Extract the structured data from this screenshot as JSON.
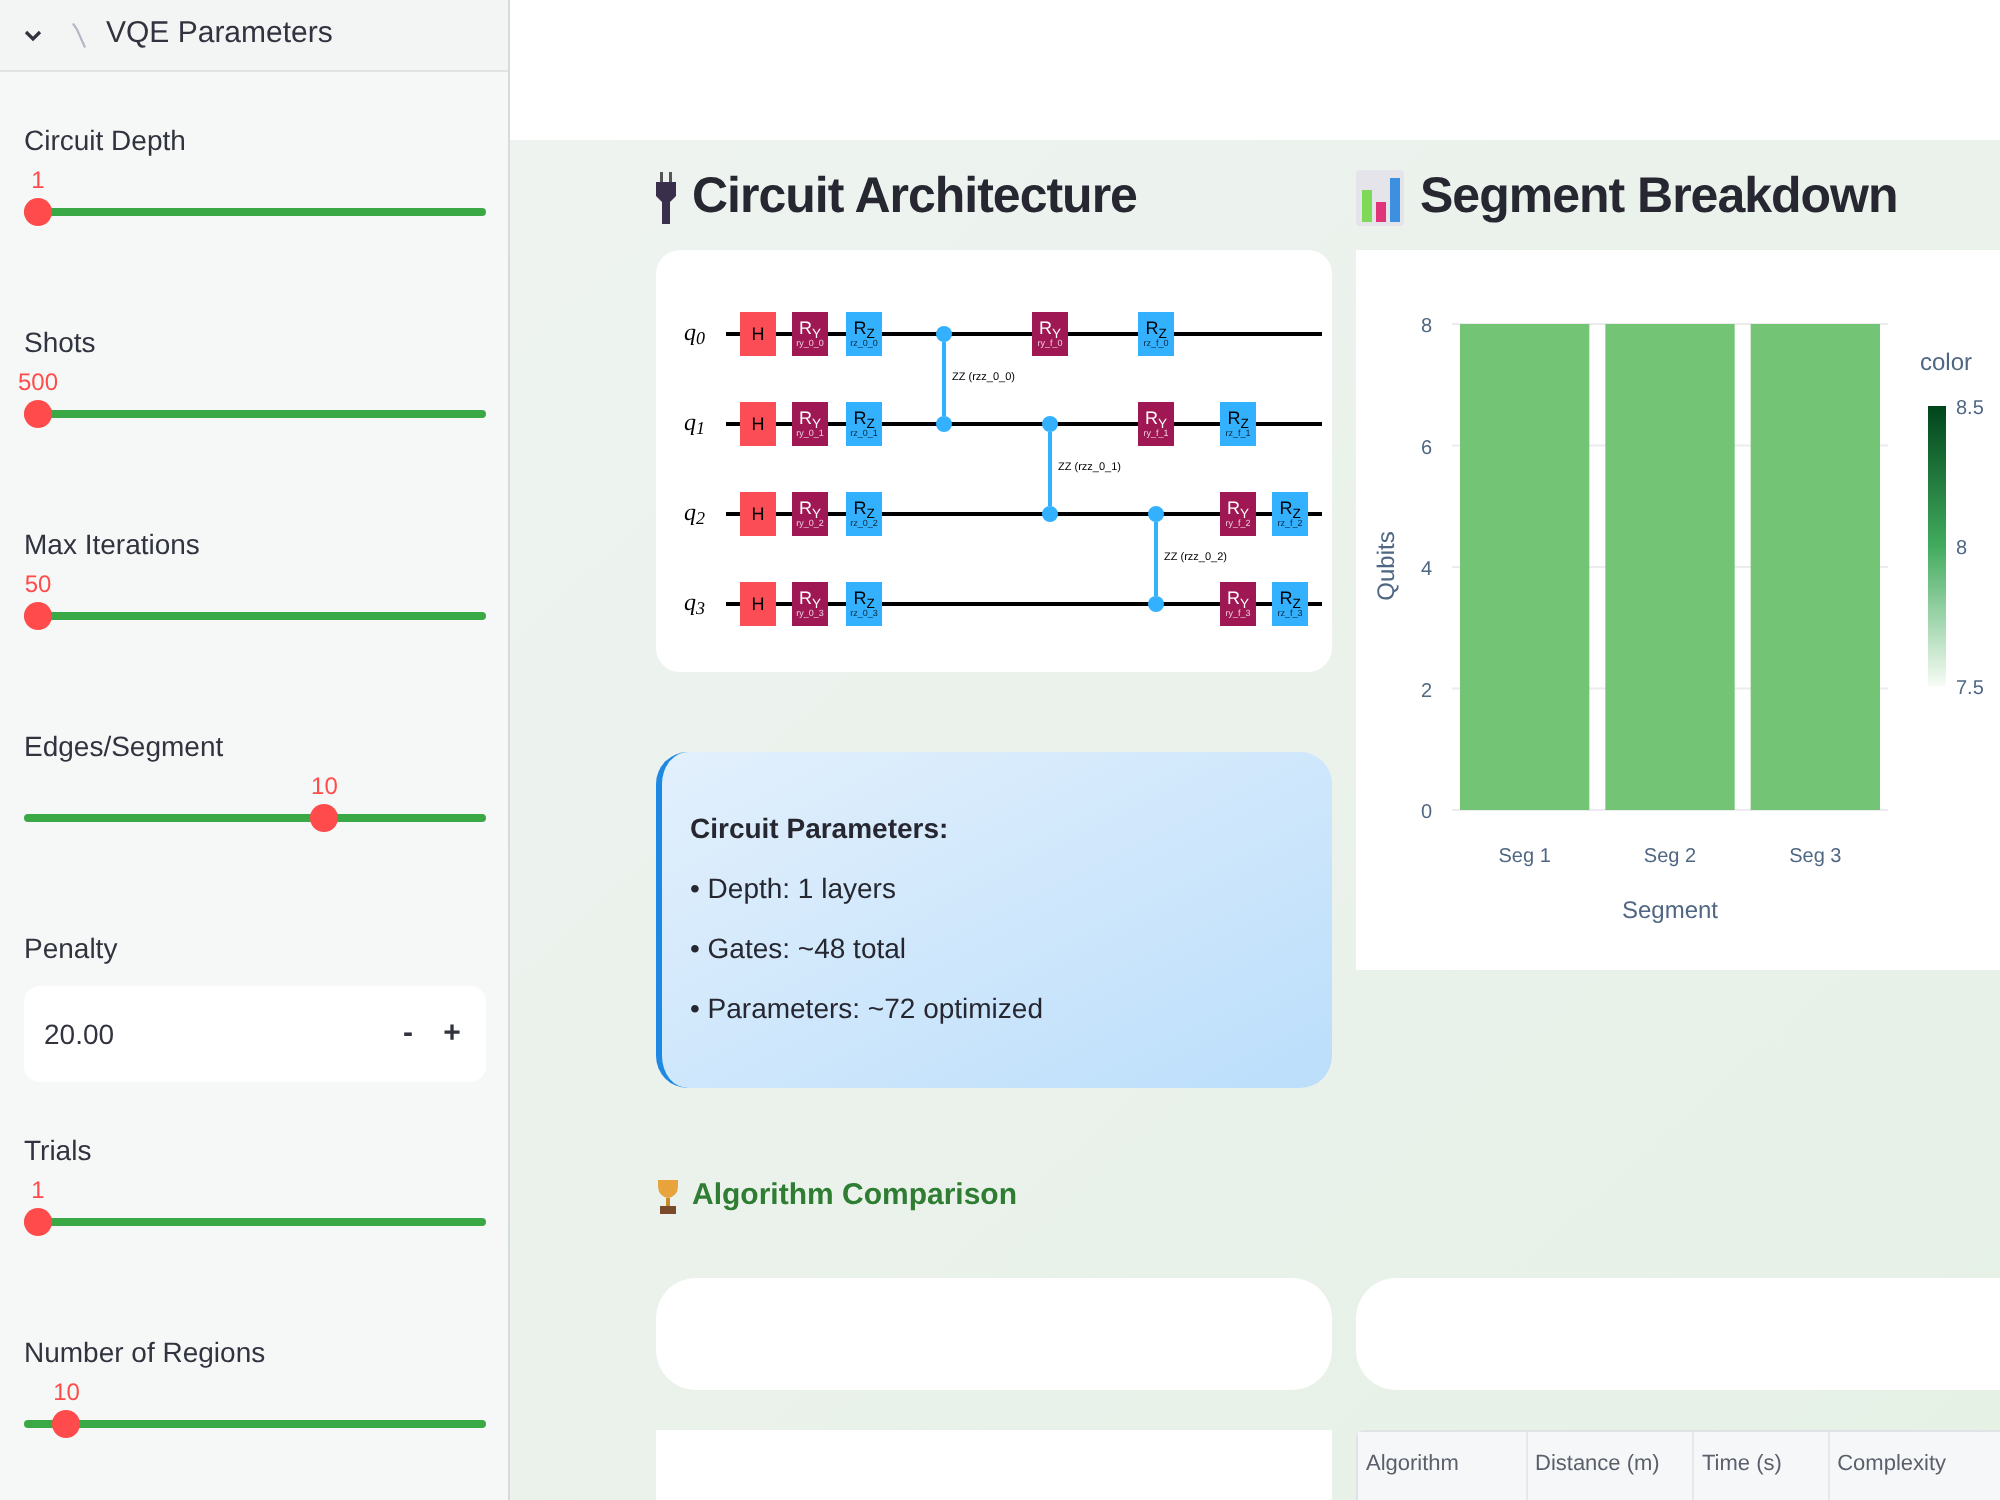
{
  "sidebar": {
    "section": {
      "title": "VQE Parameters",
      "expanded": true
    },
    "controls": [
      {
        "kind": "slider",
        "label": "Circuit Depth",
        "value": "1",
        "level": 0
      },
      {
        "kind": "slider",
        "label": "Shots",
        "value": "500",
        "level": 0
      },
      {
        "kind": "slider",
        "label": "Max Iterations",
        "value": "50",
        "level": 0
      },
      {
        "kind": "slider",
        "label": "Edges/Segment",
        "value": "10",
        "level": 0.66
      },
      {
        "kind": "number",
        "label": "Penalty",
        "value": "20.00",
        "minus": "-",
        "plus": "+"
      },
      {
        "kind": "slider",
        "label": "Trials",
        "value": "1",
        "level": 0
      },
      {
        "kind": "slider",
        "label": "Number of Regions",
        "value": "10",
        "level": 0.066
      }
    ]
  },
  "circuit": {
    "title": "Circuit Architecture",
    "qubits": [
      "q$_{0}$",
      "q$_{1}$",
      "q$_{2}$",
      "q$_{3}$"
    ],
    "columns": [
      {
        "ops": [
          {
            "kind": "h",
            "label": "H"
          },
          {
            "kind": "h",
            "label": "H"
          },
          {
            "kind": "h",
            "label": "H"
          },
          {
            "kind": "h",
            "label": "H"
          }
        ]
      },
      {
        "ops": [
          {
            "kind": "ry",
            "label": "R$_{Y}$",
            "param": "ry_0_0"
          },
          {
            "kind": "ry",
            "label": "R$_{Y}$",
            "param": "ry_0_1"
          },
          {
            "kind": "ry",
            "label": "R$_{Y}$",
            "param": "ry_0_2"
          },
          {
            "kind": "ry",
            "label": "R$_{Y}$",
            "param": "ry_0_3"
          }
        ]
      },
      {
        "ops": [
          {
            "kind": "rz",
            "label": "R$_{Z}$",
            "param": "rz_0_0"
          },
          {
            "kind": "rz",
            "label": "R$_{Z}$",
            "param": "rz_0_1"
          },
          {
            "kind": "rz",
            "label": "R$_{Z}$",
            "param": "rz_0_2"
          },
          {
            "kind": "rz",
            "label": "R$_{Z}$",
            "param": "rz_0_3"
          }
        ]
      },
      {
        "label": "ZZ (rzz_0_0)",
        "ops": [
          {
            "kind": "control"
          },
          {
            "kind": "control"
          },
          {
            "kind": "wire"
          },
          {
            "kind": "wire"
          }
        ]
      },
      {
        "label": "ZZ (rzz_0_1)",
        "ops": [
          {
            "kind": "ry",
            "label": "R$_{Y}$",
            "param": "ry_f_0"
          },
          {
            "kind": "control"
          },
          {
            "kind": "control"
          },
          {
            "kind": "wire"
          }
        ]
      },
      {
        "label": "ZZ (rzz_0_2)",
        "ops": [
          {
            "kind": "rz",
            "label": "R$_{Z}$",
            "param": "rz_f_0"
          },
          {
            "kind": "ry",
            "label": "R$_{Y}$",
            "param": "ry_f_1"
          },
          {
            "kind": "control"
          },
          {
            "kind": "control"
          }
        ]
      },
      {
        "ops": [
          {
            "kind": "wire"
          },
          {
            "kind": "rz",
            "label": "R$_{Z}$",
            "param": "rz_f_1"
          },
          {
            "kind": "ry",
            "label": "R$_{Y}$",
            "param": "ry_f_2"
          },
          {
            "kind": "ry",
            "label": "R$_{Y}$",
            "param": "ry_f_3"
          }
        ]
      },
      {
        "ops": [
          {
            "kind": "wire"
          },
          {
            "kind": "wire"
          },
          {
            "kind": "rz",
            "label": "R$_{Z}$",
            "param": "rz_f_2"
          },
          {
            "kind": "rz",
            "label": "R$_{Z}$",
            "param": "rz_f_3"
          }
        ]
      }
    ]
  },
  "circuit_parameters": {
    "title": "Circuit Parameters:",
    "items": [
      "• Depth: 1 layers",
      "• Gates: ~48 total",
      "• Parameters: ~72 optimized"
    ]
  },
  "algorithm_comparison": {
    "title": "Algorithm Comparison",
    "table": {
      "columns": [
        "Algorithm",
        "Distance (m)",
        "Time (s)",
        "Complexity"
      ]
    }
  },
  "segment_breakdown": {
    "title": "Segment Breakdown",
    "chart_data": {
      "type": "bar",
      "xlabel": "Segment",
      "ylabel": "Qubits",
      "categories": [
        "Seg 1",
        "Seg 2",
        "Seg 3"
      ],
      "series": [
        {
          "color": "#74c476",
          "values": [
            8,
            8,
            8
          ]
        }
      ],
      "ylim": [
        0,
        8
      ],
      "yticks": [
        0,
        2,
        4,
        6,
        8
      ],
      "grid": true
    },
    "colorbar": {
      "title": "color",
      "ticks": [
        "8.5",
        "8",
        "7.5"
      ]
    }
  }
}
